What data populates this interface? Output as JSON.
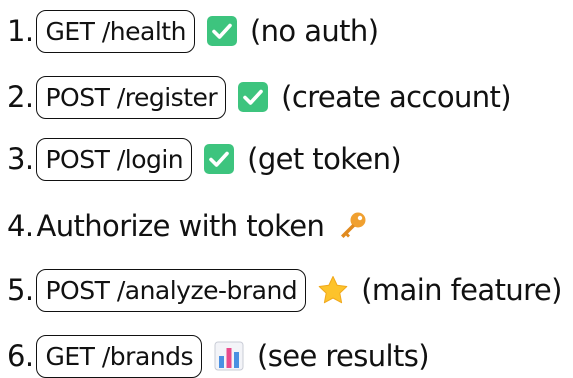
{
  "steps": [
    {
      "number": "1.",
      "endpoint": "GET /health",
      "icon": "check-icon",
      "note": "(no auth)"
    },
    {
      "number": "2.",
      "endpoint": "POST /register",
      "icon": "check-icon",
      "note": "(create account)"
    },
    {
      "number": "3.",
      "endpoint": "POST /login",
      "icon": "check-icon",
      "note": "(get token)"
    },
    {
      "number": "4.",
      "text": "Authorize with token",
      "icon": "key-icon"
    },
    {
      "number": "5.",
      "endpoint": "POST /analyze-brand",
      "icon": "star-icon",
      "note": "(main feature)"
    },
    {
      "number": "6.",
      "endpoint": "GET /brands",
      "icon": "bar-chart-icon",
      "note": "(see results)"
    }
  ],
  "colors": {
    "check": "#3dc47e",
    "key": "#f0a030",
    "star": "#fdc32b",
    "text": "#111111"
  }
}
